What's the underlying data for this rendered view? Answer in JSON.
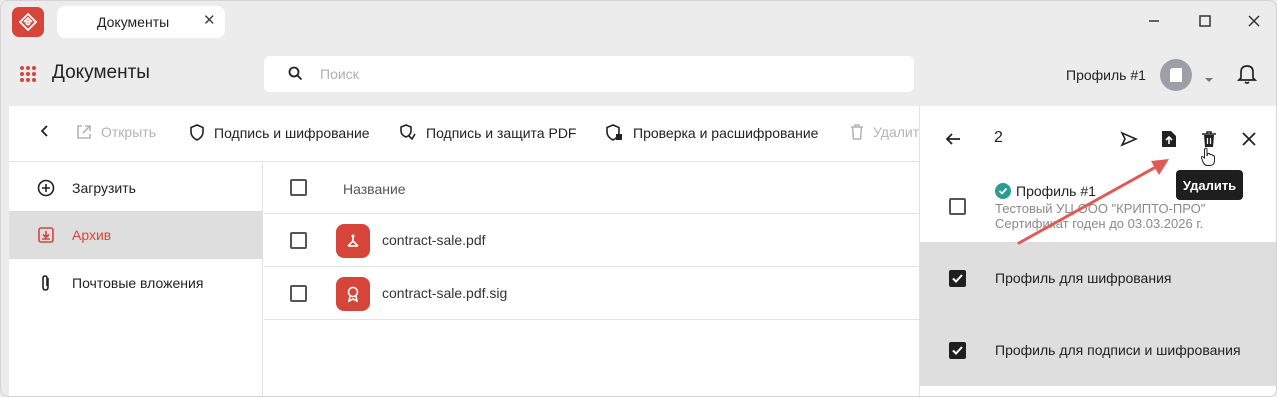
{
  "window": {
    "tab_label": "Документы",
    "tab_close": "✕"
  },
  "header": {
    "app_title": "Документы",
    "search_placeholder": "Поиск",
    "profile_name": "Профиль #1"
  },
  "toolbar": {
    "open_label": "Открыть",
    "sign_encrypt_label": "Подпись и шифрование",
    "sign_protect_pdf_label": "Подпись и защита PDF",
    "verify_decrypt_label": "Проверка и расшифрование",
    "delete_label": "Удалит"
  },
  "sidebar": {
    "items": [
      {
        "label": "Загрузить"
      },
      {
        "label": "Архив"
      },
      {
        "label": "Почтовые вложения"
      }
    ]
  },
  "filelist": {
    "column_name": "Название",
    "files": [
      {
        "name": "contract-sale.pdf"
      },
      {
        "name": "contract-sale.pdf.sig"
      }
    ]
  },
  "panel": {
    "selected_count": "2",
    "tooltip": "Удалить",
    "profiles": [
      {
        "title": "Профиль #1",
        "line1": "Тестовый УЦ ООО \"КРИПТО-ПРО\"",
        "line2": "Сертификат годен до 03.03.2026 г.",
        "checked": false
      },
      {
        "title": "Профиль для шифрования",
        "checked": true
      },
      {
        "title": "Профиль для подписи и шифрования",
        "checked": true
      }
    ]
  },
  "colors": {
    "accent": "#d5453a",
    "verified": "#2a9d8f",
    "annotation_arrow": "#e05a55"
  }
}
